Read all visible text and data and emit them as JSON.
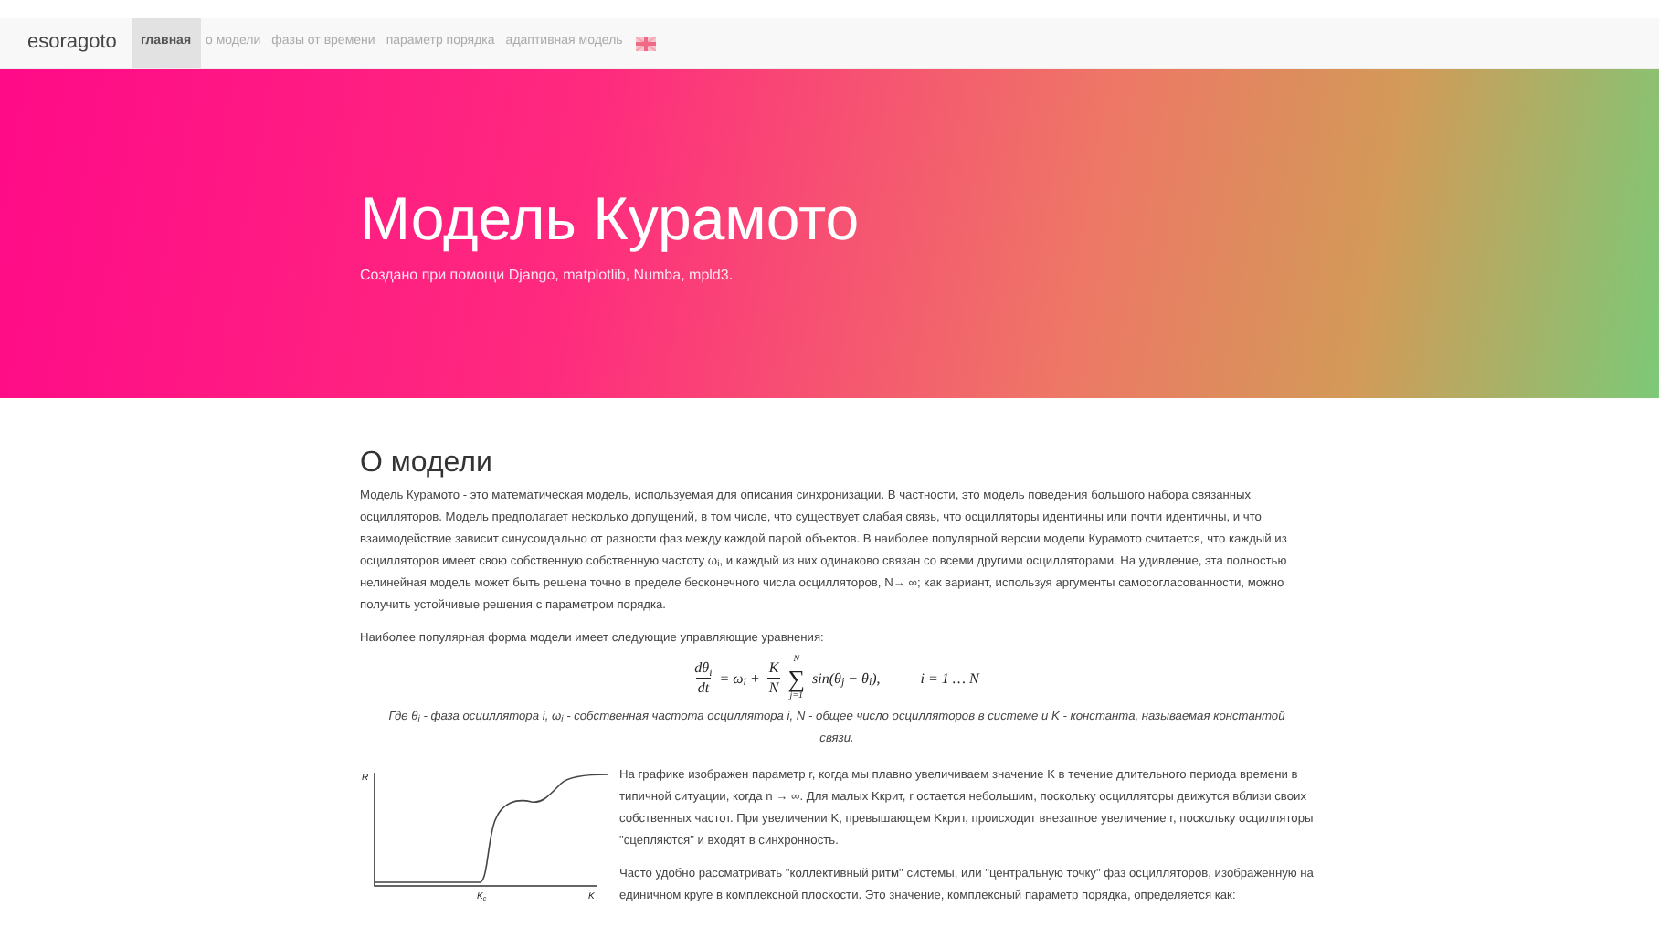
{
  "navbar": {
    "brand": "esoragoto",
    "items": [
      {
        "label": "главная",
        "selected": true
      },
      {
        "label": "о модели",
        "selected": false
      },
      {
        "label": "фазы от времени",
        "selected": false
      },
      {
        "label": "параметр порядка",
        "selected": false
      },
      {
        "label": "адаптивная модель",
        "selected": false
      }
    ]
  },
  "hero": {
    "title": "Модель Курамото",
    "subtitle": "Создано при помощи Django, matplotlib, Numba, mpld3."
  },
  "section": {
    "heading": "О модели",
    "intro": "Модель Курамото - это математическая модель, используемая для описания синхронизации. В частности, это модель поведения большого набора связанных осцилляторов. Модель предполагает несколько допущений, в том числе, что существует слабая связь, что осцилляторы идентичны или почти идентичны, и что взаимодействие зависит синусоидально от разности фаз между каждой парой объектов. В наиболее популярной версии модели Курамото считается, что каждый из осцилляторов имеет свою собственную собственную частоту ω$_{i}$, и каждый из них одинаково связан со всеми другими осцилляторами. На удивление, эта полностью нелинейная модель может быть решена точно в пределе бесконечного числа осцилляторов, N→ ∞; как вариант, используя аргументы самосогласованности, можно получить устойчивые решения с параметром порядка.",
    "lead": "Наиболее популярная форма модели имеет следующие управляющие уравнения:",
    "equation": {
      "lhs_num": "dθ$_{i}$",
      "lhs_den": "dt",
      "mid": "= ω$_{i}$ +",
      "frac_num": "K",
      "frac_den": "N",
      "sum_top": "N",
      "sum": "∑",
      "sum_bottom": "j=1",
      "term": "sin(θ$_{j}$ − θ$_{i}$),",
      "range": "i = 1 … N"
    },
    "caption": "Где θ$_{i}$ - фаза осциллятора i, ω$_{i}$ - собственная частота осциллятора i, N - общее число осцилляторов в системе и K - константа, называемая константой связи.",
    "graph": {
      "y_label": "R",
      "x_mark": "K$_{c}$",
      "x_label": "K"
    },
    "graph_text": "На графике изображен параметр r, когда мы плавно увеличиваем значение K в течение длительного периода времени в типичной ситуации, когда n → ∞. Для малых Kкрит, r остается небольшим, поскольку осцилляторы движутся вблизи своих собственных частот. При увеличении K, превышающем Kкрит, происходит внезапное увеличение r, поскольку осцилляторы \"сцепляются\" и входят в синхронность.",
    "rhythm_text": "Часто удобно рассматривать \"коллективный ритм\" системы, или \"центральную точку\" фаз осцилляторов, изображенную на единичном круге в комплексной плоскости. Это значение, комплексный параметр порядка, определяется как:"
  }
}
